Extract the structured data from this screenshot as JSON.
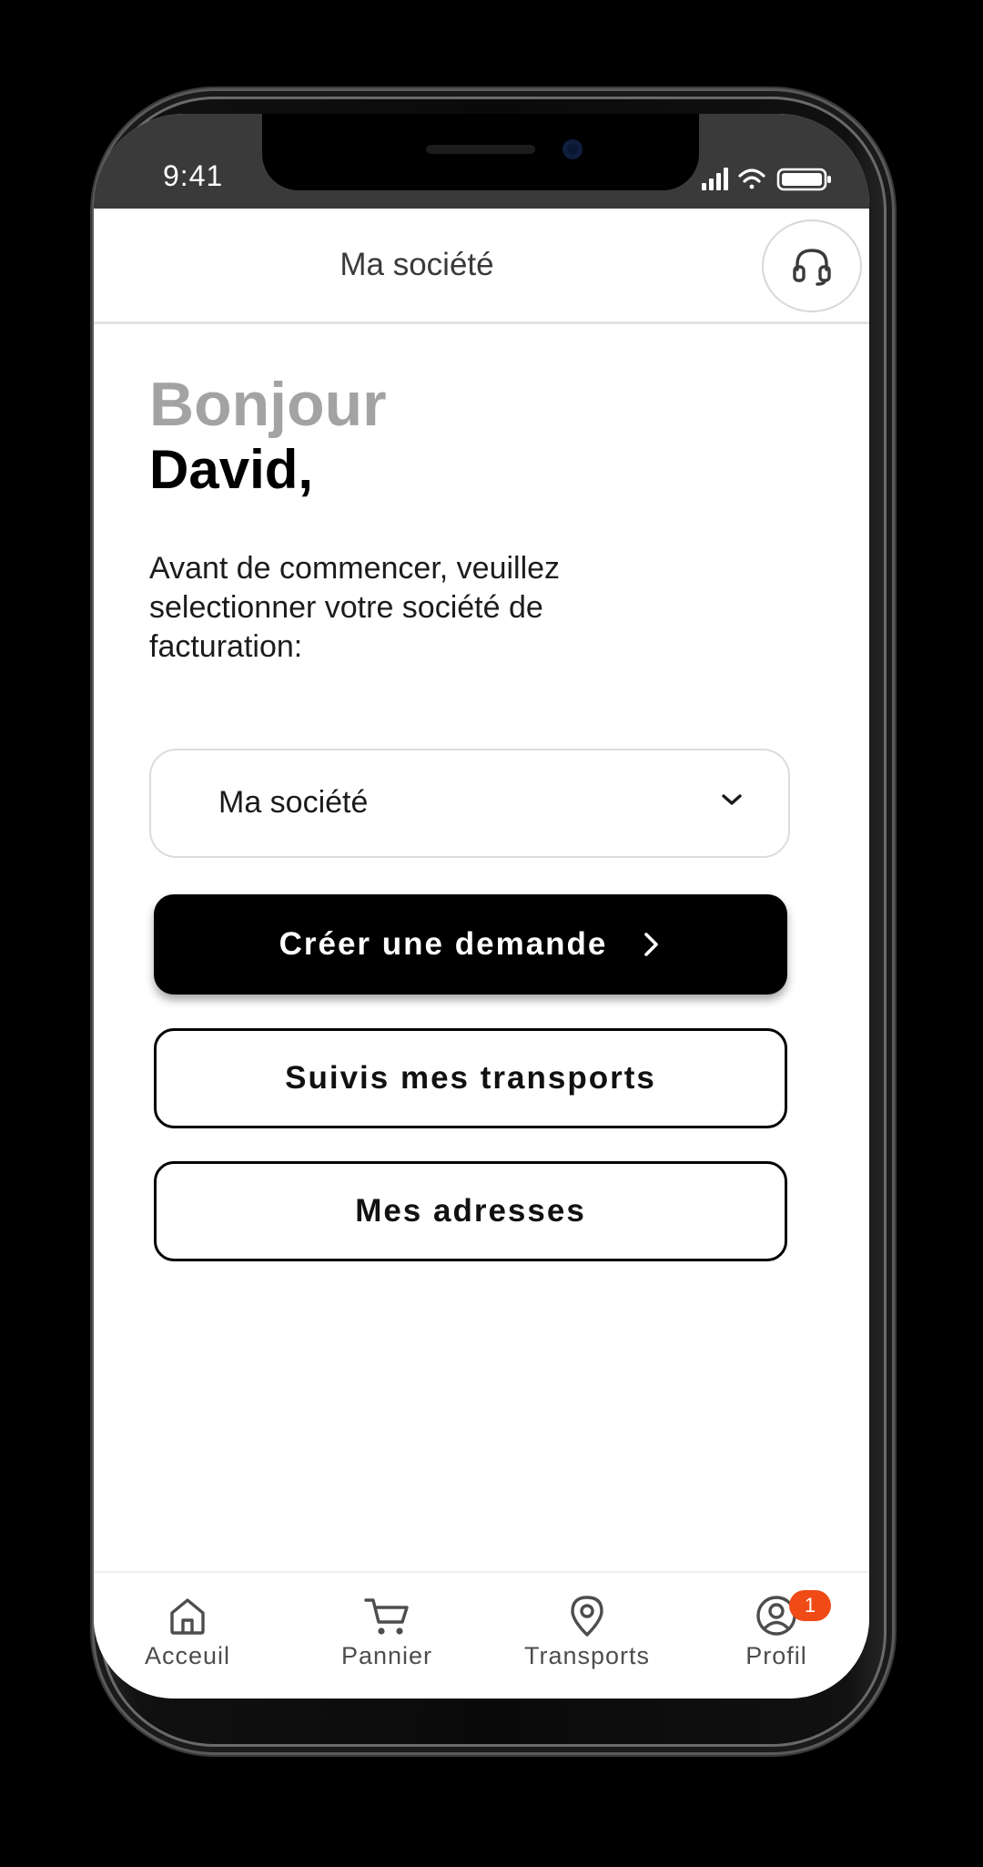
{
  "status_bar": {
    "time": "9:41"
  },
  "header": {
    "title": "Ma société",
    "support_icon": "headset-icon"
  },
  "greeting": {
    "hello": "Bonjour",
    "name": "David,"
  },
  "instructions": "Avant de commencer, veuillez selectionner votre société de facturation:",
  "company_select": {
    "value": "Ma société",
    "icon": "chevron-down-icon"
  },
  "actions": {
    "create_request": "Créer une demande",
    "track_transports": "Suivis mes transports",
    "my_addresses": "Mes adresses"
  },
  "bottom_nav": {
    "items": [
      {
        "label": "Acceuil",
        "icon": "home-icon"
      },
      {
        "label": "Pannier",
        "icon": "cart-icon"
      },
      {
        "label": "Transports",
        "icon": "map-pin-icon"
      },
      {
        "label": "Profil",
        "icon": "user-icon",
        "badge": "1"
      }
    ]
  },
  "colors": {
    "badge": "#f04a16",
    "primary_button": "#000000",
    "greeting_muted": "#a3a3a3",
    "status_bar": "#3a3a3a"
  }
}
